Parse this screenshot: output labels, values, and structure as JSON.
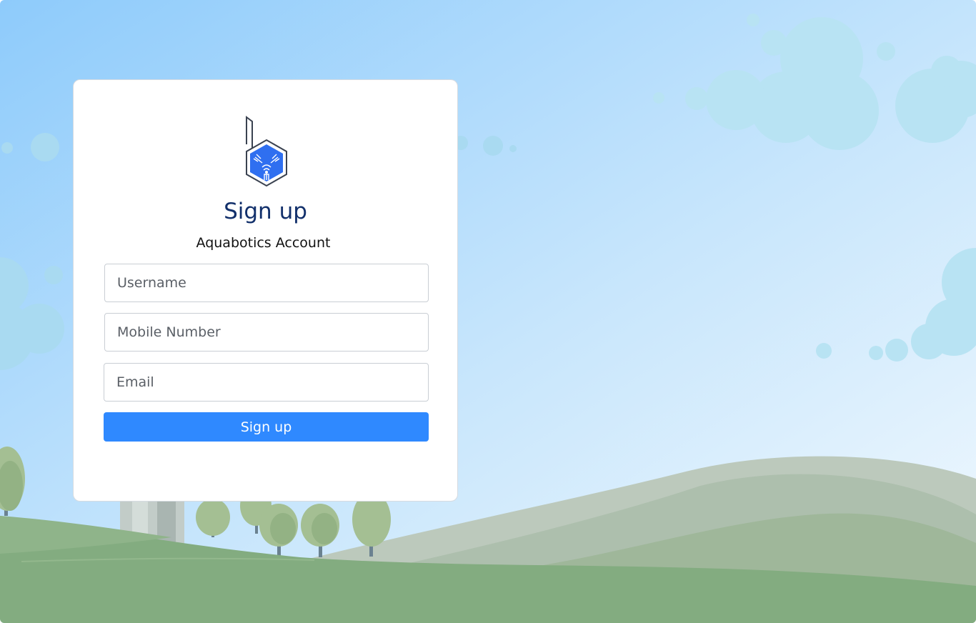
{
  "signup": {
    "title": "Sign up",
    "subtitle": "Aquabotics Account",
    "username_placeholder": "Username",
    "mobile_placeholder": "Mobile Number",
    "email_placeholder": "Email",
    "submit_label": "Sign up"
  },
  "colors": {
    "accent": "#2f89ff",
    "title": "#12306b",
    "sky_top": "#8ecbfb",
    "sky_bottom": "#eaf6fe",
    "grass": "#83ac80"
  },
  "icons": {
    "logo": "aquabotics-hexagon-logo-icon"
  }
}
